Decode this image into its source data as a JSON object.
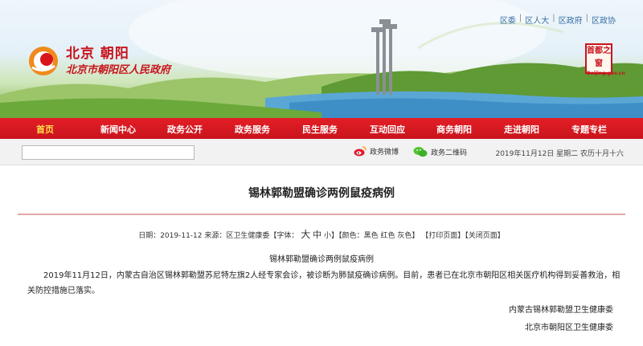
{
  "header": {
    "top_links": [
      "区委",
      "区人大",
      "区政府",
      "区政协"
    ],
    "site_title": "北京 朝阳",
    "site_subtitle": "北京市朝阳区人民政府",
    "seal_text": "首都之窗",
    "seal_small": "Beijing.gov.cn"
  },
  "nav": {
    "items": [
      "首页",
      "新闻中心",
      "政务公开",
      "政务服务",
      "民生服务",
      "互动回应",
      "商务朝阳",
      "走进朝阳",
      "专题专栏"
    ]
  },
  "subbar": {
    "search_value": "",
    "weibo_label": "政务微博",
    "weixin_label": "政务二维码",
    "date_text": "2019年11月12日  星期二  农历十月十六"
  },
  "article": {
    "title": "锡林郭勒盟确诊两例鼠疫病例",
    "meta_date": "日期：2019-11-12",
    "meta_source": "来源：区卫生健康委",
    "font_label": "【字体：",
    "font_big": "大",
    "font_mid": "中",
    "font_small": "小",
    "color_label": "】【颜色：",
    "color_black": "黑色",
    "color_red": "红色",
    "color_gray": "灰色",
    "color_end": "】",
    "print_link": "【打印页面】",
    "close_link": "【关闭页面】",
    "sub_title": "锡林郭勒盟确诊两例鼠疫病例",
    "body": "2019年11月12日，内蒙古自治区锡林郭勒盟苏尼特左旗2人经专家会诊，被诊断为肺鼠疫确诊病例。目前，患者已在北京市朝阳区相关医疗机构得到妥善救治，相关防控措施已落实。",
    "sign_1": "内蒙古锡林郭勒盟卫生健康委",
    "sign_2": "北京市朝阳区卫生健康委"
  },
  "colors": {
    "nav_red": "#c8141c",
    "home_yellow": "#ffe14a",
    "title_red": "#c8141c"
  }
}
